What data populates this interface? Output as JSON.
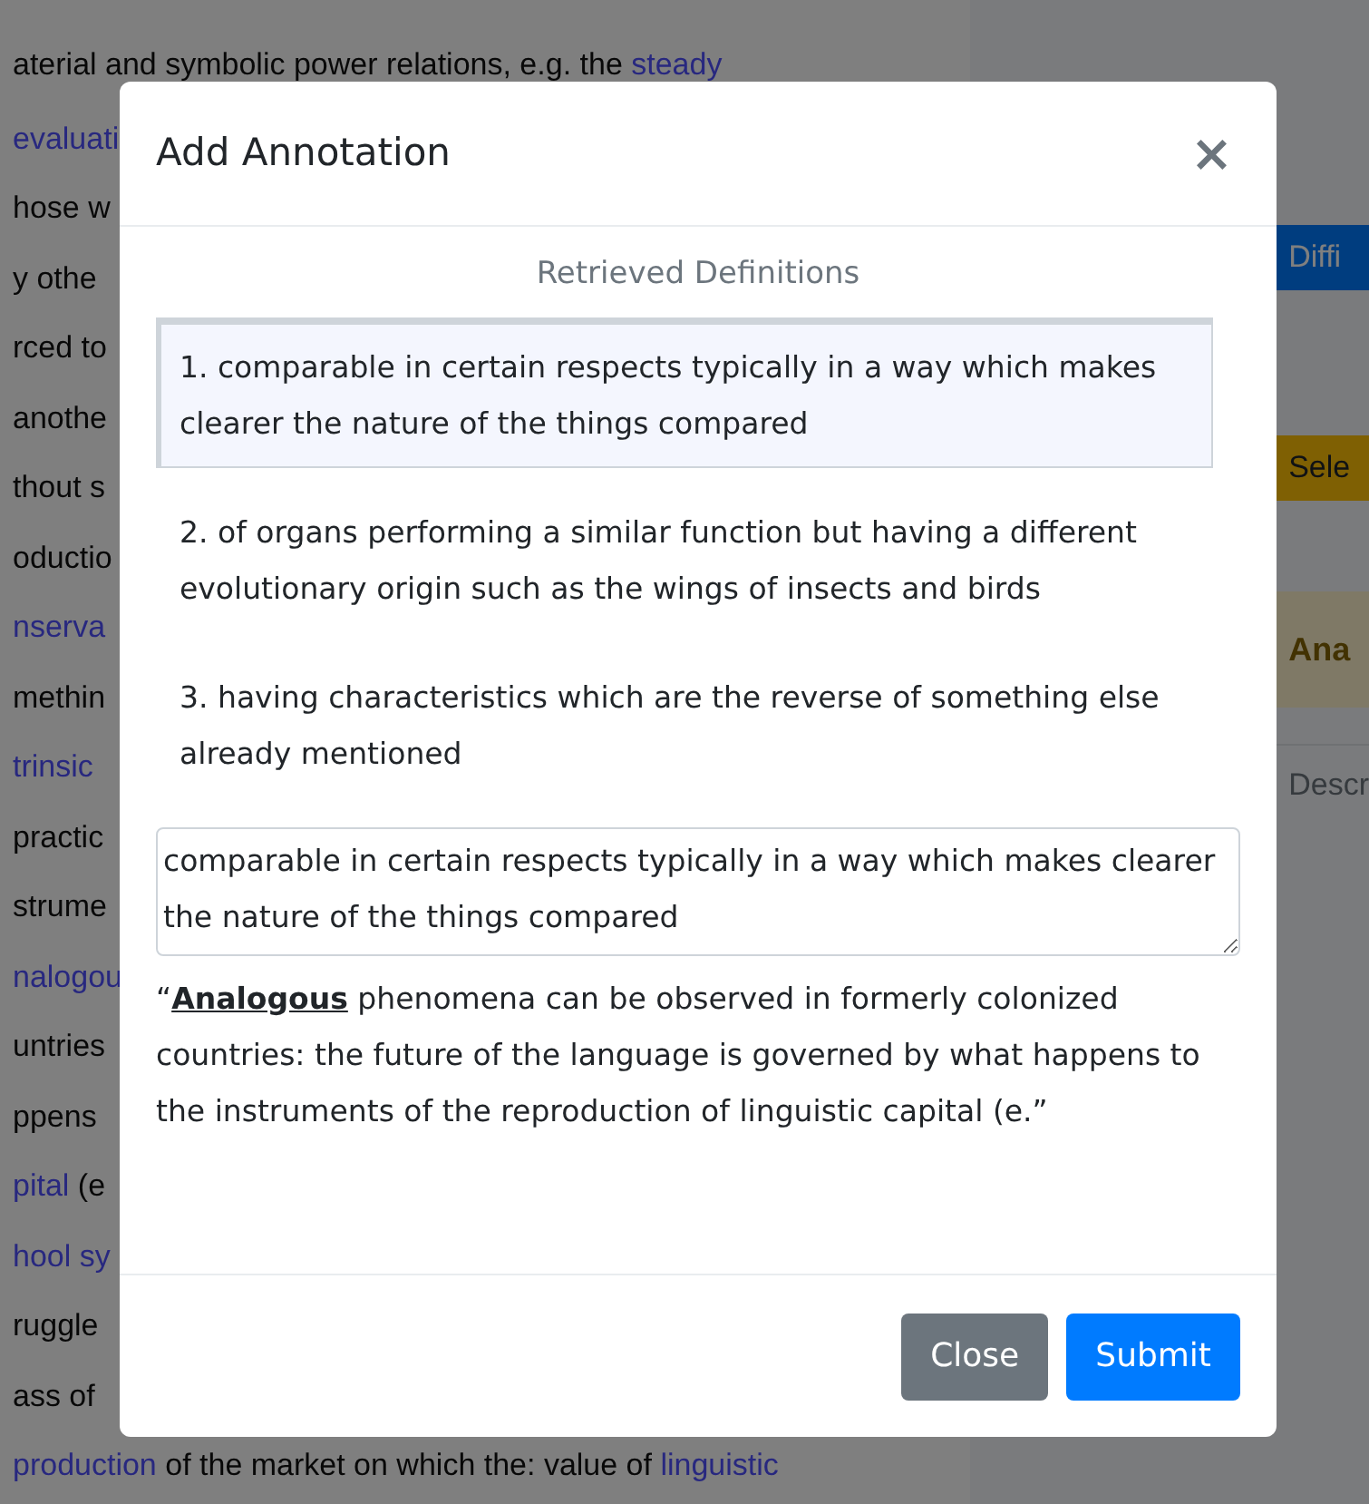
{
  "background": {
    "lines": [
      {
        "segments": [
          {
            "text": "aterial and symbolic power relations, e.g. the ",
            "link": false
          },
          {
            "text": "steady",
            "link": true
          }
        ]
      },
      {
        "segments": [
          {
            "text": "evaluati",
            "link": true
          }
        ]
      },
      {
        "segments": [
          {
            "text": "hose w",
            "link": false
          }
        ]
      },
      {
        "segments": [
          {
            "text": "y othe",
            "link": false
          }
        ]
      },
      {
        "segments": [
          {
            "text": "rced to",
            "link": false
          }
        ]
      },
      {
        "segments": [
          {
            "text": "anothe",
            "link": false
          }
        ]
      },
      {
        "segments": [
          {
            "text": "thout s",
            "link": false
          }
        ]
      },
      {
        "segments": [
          {
            "text": "oductio",
            "link": false
          }
        ]
      },
      {
        "segments": [
          {
            "text": "nserva",
            "link": true
          }
        ]
      },
      {
        "segments": [
          {
            "text": "methin",
            "link": false
          }
        ]
      },
      {
        "segments": [
          {
            "text": "trinsic",
            "link": true
          }
        ]
      },
      {
        "segments": [
          {
            "text": "practic",
            "link": false
          }
        ]
      },
      {
        "segments": [
          {
            "text": "strume",
            "link": false
          }
        ]
      },
      {
        "segments": [
          {
            "text": "nalogou",
            "link": true
          }
        ]
      },
      {
        "segments": [
          {
            "text": "untries",
            "link": false
          }
        ]
      },
      {
        "segments": [
          {
            "text": "ppens",
            "link": false
          }
        ]
      },
      {
        "segments": [
          {
            "text": "pital",
            "link": true
          },
          {
            "text": " (e",
            "link": false
          }
        ]
      },
      {
        "segments": [
          {
            "text": "hool sy",
            "link": true
          }
        ]
      },
      {
        "segments": [
          {
            "text": "ruggle",
            "link": false
          }
        ]
      },
      {
        "segments": [
          {
            "text": "ass of",
            "link": false
          }
        ]
      },
      {
        "segments": [
          {
            "text": "production",
            "link": true
          },
          {
            "text": " of the market on which the: value of ",
            "link": false
          },
          {
            "text": "linguistic",
            "link": true
          }
        ]
      }
    ]
  },
  "side_panel": {
    "items": [
      {
        "kind": "primary",
        "label": "Diffi"
      },
      {
        "kind": "warning",
        "label": "Sele"
      },
      {
        "kind": "highlight",
        "label": "Ana"
      },
      {
        "kind": "text",
        "label": "Descr"
      }
    ]
  },
  "modal": {
    "title": "Add Annotation",
    "close": "×",
    "subheading": "Retrieved Definitions",
    "definitions": [
      {
        "text": "1. comparable in certain respects typically in a way which makes clearer the nature of the things compared",
        "selected": true
      },
      {
        "text": "2. of organs performing a similar function but having a different evolutionary origin such as the wings of insects and birds",
        "selected": false
      },
      {
        "text": "3. having characteristics which are the reverse of something else already mentioned",
        "selected": false
      }
    ],
    "textarea_value": "comparable in certain respects typically in a way which makes clearer the nature of the things compared",
    "quote": "“**Analogous** phenomena can be observed in formerly colonized countries: the future of the language is governed by what happens to the instruments of the reproduction of linguistic capital (e.”",
    "buttons": [
      {
        "label": "Close",
        "kind": "secondary"
      },
      {
        "label": "Submit",
        "kind": "primary"
      }
    ]
  }
}
